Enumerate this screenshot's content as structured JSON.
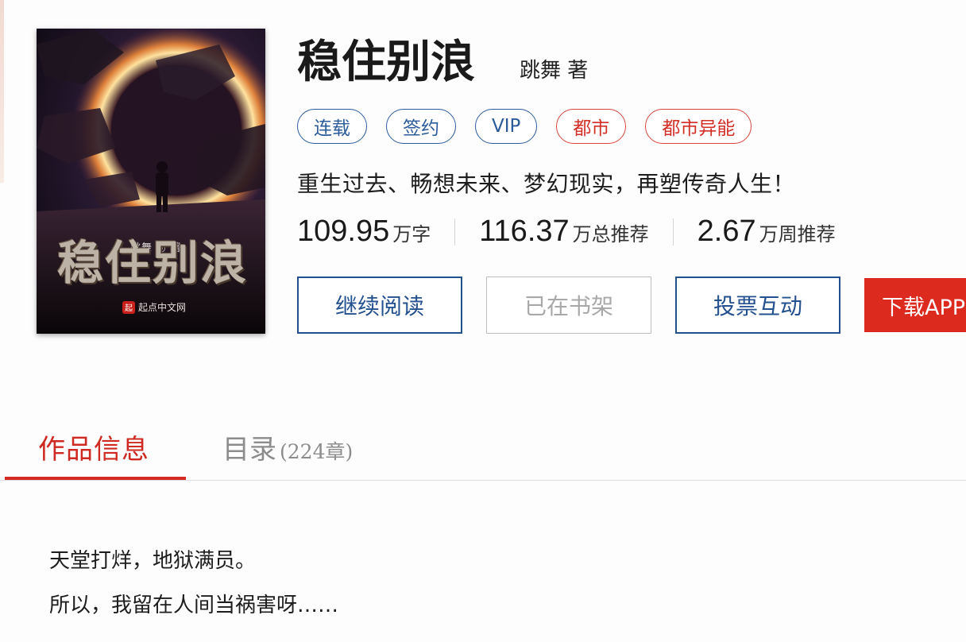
{
  "cover": {
    "author_label": "跳舞 ◎ 著",
    "title_art": "稳住别浪",
    "publisher": "起点中文网",
    "publisher_logo": "起"
  },
  "book": {
    "title": "稳住别浪",
    "author": "跳舞  著",
    "tags": [
      {
        "label": "连载",
        "color": "#2b5b9a"
      },
      {
        "label": "签约",
        "color": "#2b5b9a"
      },
      {
        "label": "VIP",
        "color": "#2b5b9a"
      },
      {
        "label": "都市",
        "color": "#d42f27"
      },
      {
        "label": "都市异能",
        "color": "#d42f27"
      }
    ],
    "intro": "重生过去、畅想未来、梦幻现实，再塑传奇人生！",
    "stats": [
      {
        "value": "109.95",
        "unit": "万字"
      },
      {
        "value": "116.37",
        "unit": "万总推荐"
      },
      {
        "value": "2.67",
        "unit": "万周推荐"
      }
    ]
  },
  "actions": {
    "continue_reading": "继续阅读",
    "on_shelf": "已在书架",
    "vote": "投票互动",
    "download_app": "下载APP"
  },
  "tabs": {
    "info": "作品信息",
    "toc": "目录",
    "toc_count": "(224章)"
  },
  "content": {
    "line1": "天堂打烊，地狱满员。",
    "line2": "所以，我留在人间当祸害呀……"
  },
  "colors": {
    "accent_blue": "#23508f",
    "accent_red": "#d42a21"
  }
}
